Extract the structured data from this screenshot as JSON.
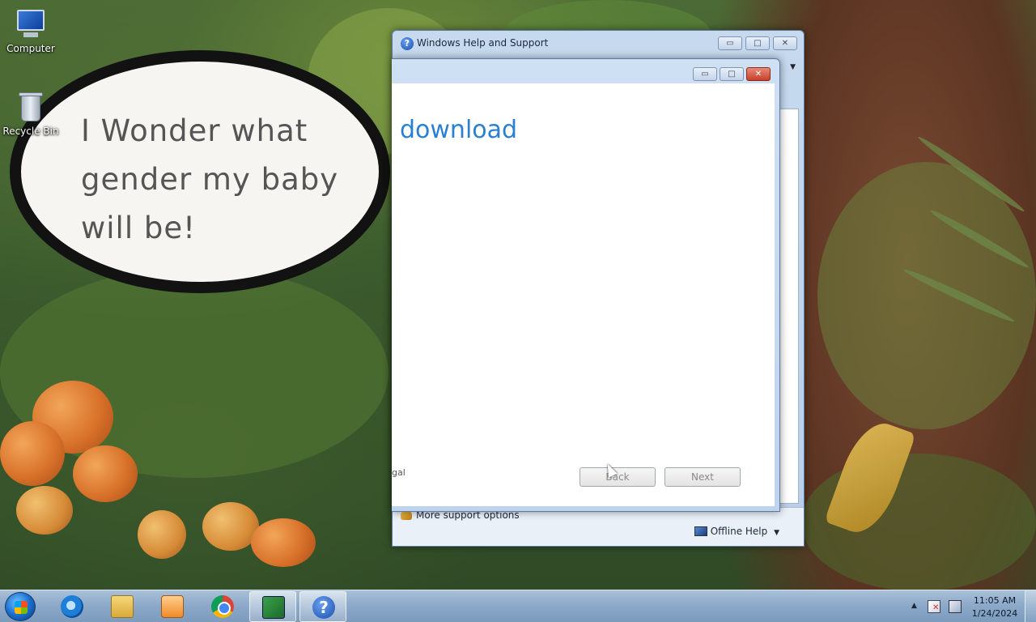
{
  "desktop": {
    "icons": [
      {
        "label": "Computer"
      },
      {
        "label": "Recycle Bin"
      }
    ],
    "wallpaper_bubble_text": "I Wonder what gender my baby will be!"
  },
  "help_window": {
    "title": "Windows Help and Support",
    "caption_buttons": {
      "minimize": "▭",
      "maximize": "□",
      "close": "✕"
    },
    "footer": {
      "support_link": "More support options",
      "offline_help": "Offline Help",
      "offline_arrow": "▼"
    },
    "dropdown_arrow": "▼",
    "title_icon": "?"
  },
  "wizard_window": {
    "caption_buttons": {
      "minimize": "▭",
      "maximize": "□",
      "close": "✕"
    },
    "heading": "download",
    "legal_text": "gal",
    "back_label": "Back",
    "next_label": "Next"
  },
  "taskbar": {
    "apps": [
      {
        "name": "start-button"
      },
      {
        "name": "internet-explorer"
      },
      {
        "name": "windows-explorer"
      },
      {
        "name": "windows-media-player"
      },
      {
        "name": "google-chrome"
      },
      {
        "name": "installer",
        "active": true
      },
      {
        "name": "help-and-support",
        "active": true
      }
    ],
    "help_icon_glyph": "?",
    "tray_arrow": "▲",
    "clock": {
      "time": "11:05 AM",
      "date": "1/24/2024"
    }
  },
  "colors": {
    "wizard_heading": "#2a7fd0",
    "taskbar": "#8ba8c8"
  }
}
